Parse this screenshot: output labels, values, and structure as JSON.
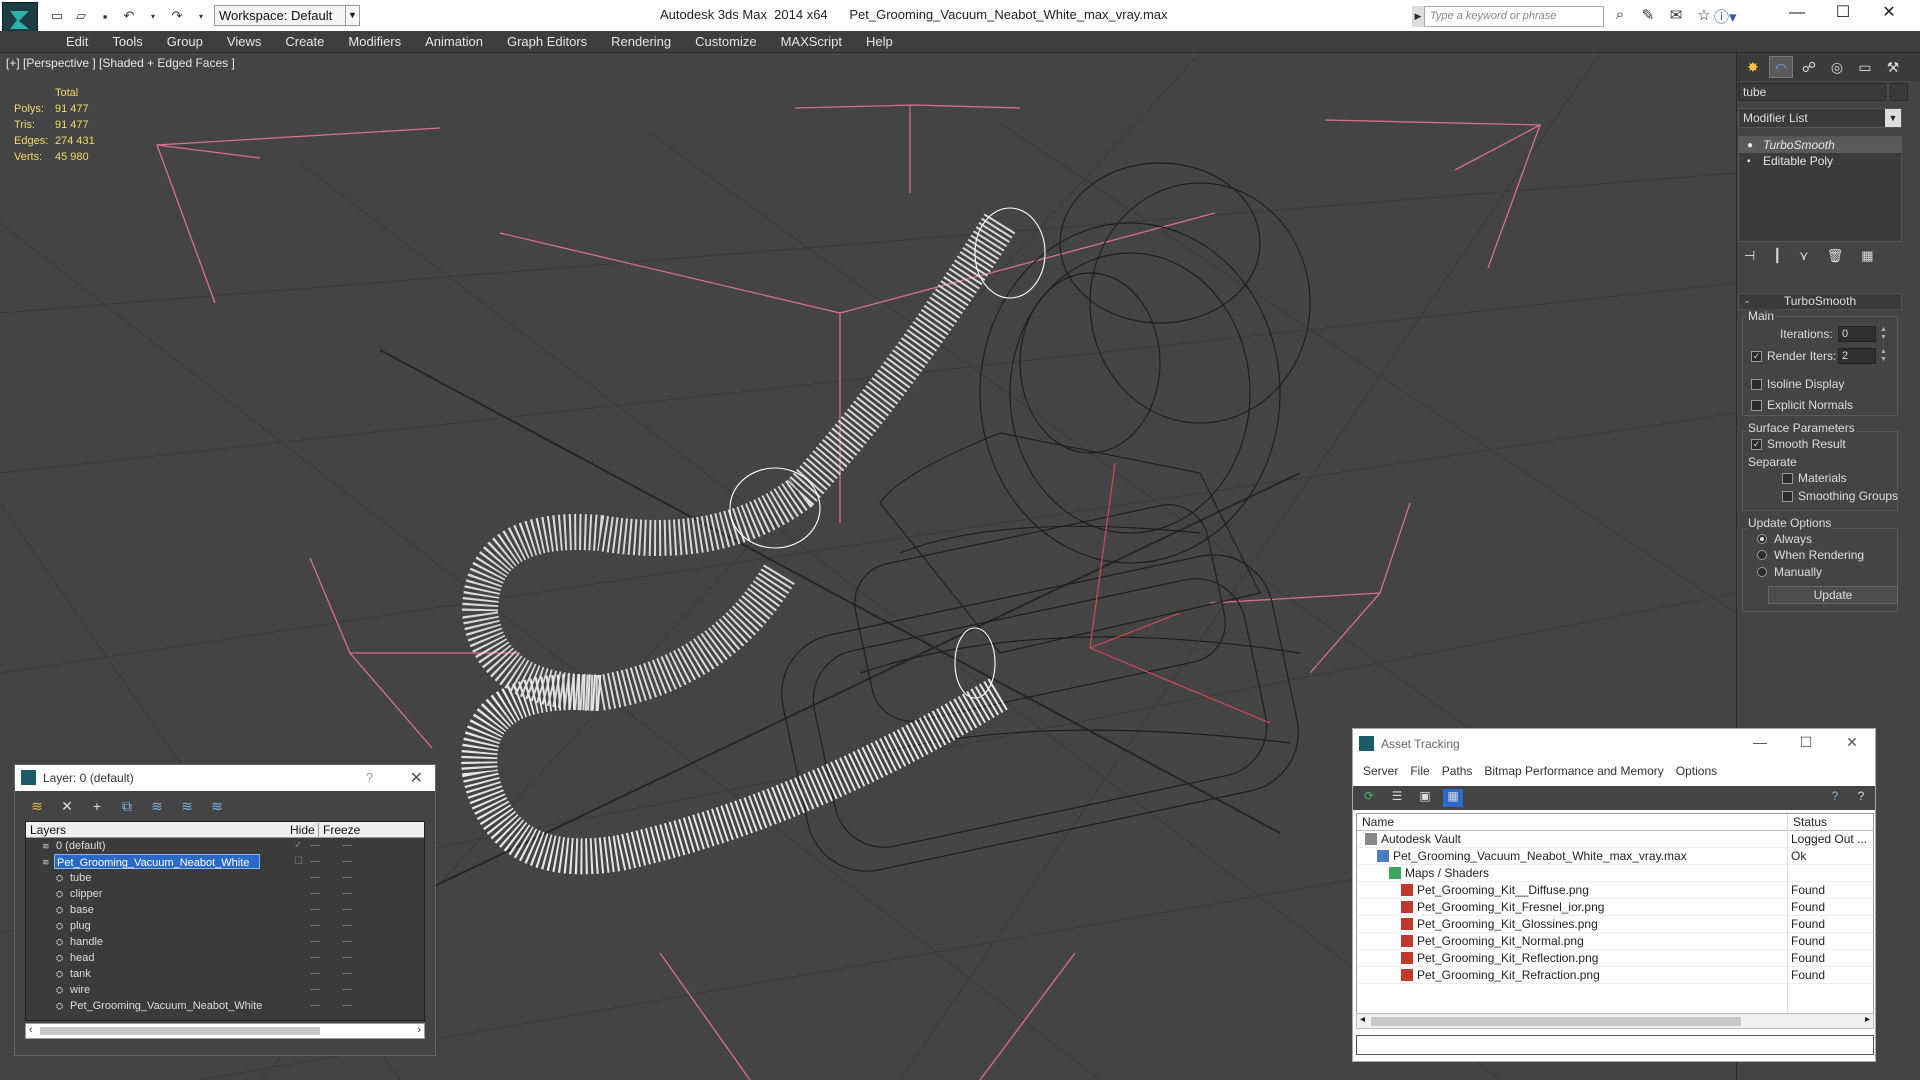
{
  "titlebar": {
    "workspace": "Workspace: Default",
    "app_name": "Autodesk 3ds Max  2014 x64",
    "file_name": "Pet_Grooming_Vacuum_Neabot_White_max_vray.max",
    "search_placeholder": "Type a keyword or phrase"
  },
  "menu": [
    "Edit",
    "Tools",
    "Group",
    "Views",
    "Create",
    "Modifiers",
    "Animation",
    "Graph Editors",
    "Rendering",
    "Customize",
    "MAXScript",
    "Help"
  ],
  "viewport": {
    "label": "[+] [Perspective ] [Shaded + Edged Faces ]",
    "stats": {
      "header": "Total",
      "polys_label": "Polys:",
      "polys": "91 477",
      "tris_label": "Tris:",
      "tris": "91 477",
      "edges_label": "Edges:",
      "edges": "274 431",
      "verts_label": "Verts:",
      "verts": "45 980"
    }
  },
  "command_panel": {
    "object_name": "tube",
    "modifier_list": "Modifier List",
    "stack": [
      "TurboSmooth",
      "Editable Poly"
    ],
    "rollout": "TurboSmooth",
    "main_group": "Main",
    "iterations_label": "Iterations:",
    "iterations": "0",
    "render_iters_label": "Render Iters:",
    "render_iters": "2",
    "isoline": "Isoline Display",
    "explicit_normals": "Explicit Normals",
    "surface_params": "Surface Parameters",
    "smooth_result": "Smooth Result",
    "separate": "Separate",
    "materials": "Materials",
    "smoothing_groups": "Smoothing Groups",
    "update_options": "Update Options",
    "always": "Always",
    "when_rendering": "When Rendering",
    "manually": "Manually",
    "update_btn": "Update"
  },
  "layer_dialog": {
    "title": "Layer: 0 (default)",
    "help": "?",
    "cols": {
      "layers": "Layers",
      "hide": "Hide",
      "freeze": "Freeze"
    },
    "rows": [
      {
        "name": "0 (default)",
        "level": 0
      },
      {
        "name": "Pet_Grooming_Vacuum_Neabot_White",
        "level": 0,
        "selected": true
      },
      {
        "name": "tube",
        "level": 1
      },
      {
        "name": "clipper",
        "level": 1
      },
      {
        "name": "base",
        "level": 1
      },
      {
        "name": "plug",
        "level": 1
      },
      {
        "name": "handle",
        "level": 1
      },
      {
        "name": "head",
        "level": 1
      },
      {
        "name": "tank",
        "level": 1
      },
      {
        "name": "wire",
        "level": 1
      },
      {
        "name": "Pet_Grooming_Vacuum_Neabot_White",
        "level": 1
      }
    ]
  },
  "asset_dialog": {
    "title": "Asset Tracking",
    "menu": [
      "Server",
      "File",
      "Paths",
      "Bitmap Performance and Memory",
      "Options"
    ],
    "cols": {
      "name": "Name",
      "status": "Status"
    },
    "rows": [
      {
        "name": "Autodesk Vault",
        "status": "Logged Out ...",
        "level": 0,
        "icon": "vault"
      },
      {
        "name": "Pet_Grooming_Vacuum_Neabot_White_max_vray.max",
        "status": "Ok",
        "level": 1,
        "icon": "max"
      },
      {
        "name": "Maps / Shaders",
        "status": "",
        "level": 2,
        "icon": "maps"
      },
      {
        "name": "Pet_Grooming_Kit__Diffuse.png",
        "status": "Found",
        "level": 3,
        "icon": "png"
      },
      {
        "name": "Pet_Grooming_Kit_Fresnel_ior.png",
        "status": "Found",
        "level": 3,
        "icon": "png"
      },
      {
        "name": "Pet_Grooming_Kit_Glossines.png",
        "status": "Found",
        "level": 3,
        "icon": "png"
      },
      {
        "name": "Pet_Grooming_Kit_Normal.png",
        "status": "Found",
        "level": 3,
        "icon": "png"
      },
      {
        "name": "Pet_Grooming_Kit_Reflection.png",
        "status": "Found",
        "level": 3,
        "icon": "png"
      },
      {
        "name": "Pet_Grooming_Kit_Refraction.png",
        "status": "Found",
        "level": 3,
        "icon": "png"
      }
    ]
  },
  "colors": {
    "stats": "#f2d86a",
    "selection": "#2a69c8",
    "viewport_bg": "#444444",
    "grid": "#3a3a3a",
    "bbox": "#d8708a"
  }
}
